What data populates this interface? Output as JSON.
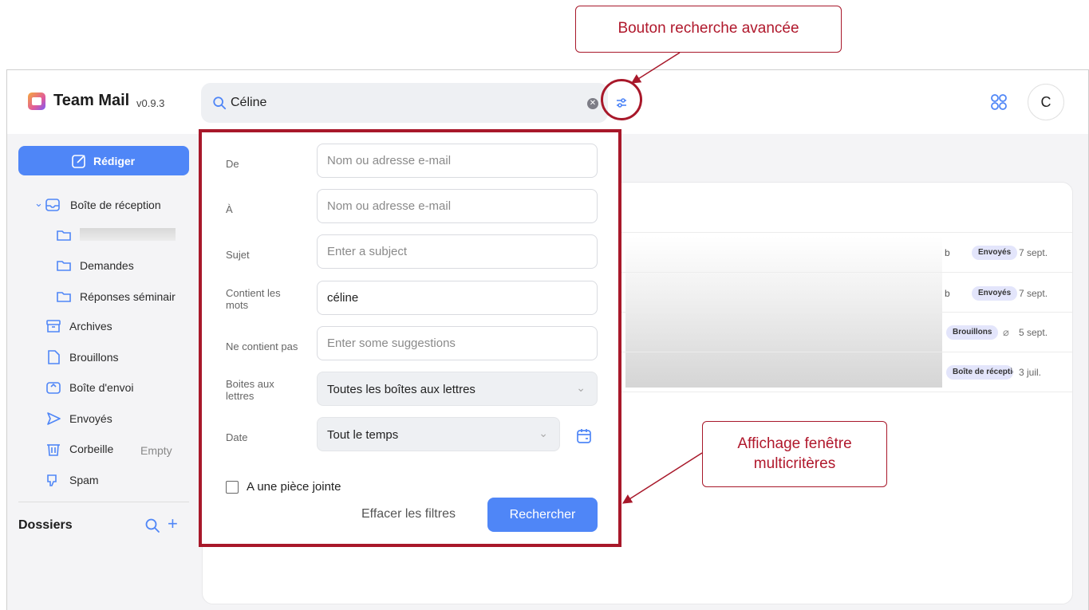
{
  "header": {
    "app_name": "Team Mail",
    "version": "v0.9.3",
    "search_value": "Céline",
    "avatar_initial": "C"
  },
  "sidebar": {
    "compose_label": "Rédiger",
    "items": [
      {
        "label": "Boîte de réception",
        "icon": "inbox-icon"
      },
      {
        "label": "",
        "icon": "folder-icon"
      },
      {
        "label": "Demandes",
        "icon": "folder-icon"
      },
      {
        "label": "Réponses séminair",
        "icon": "folder-icon"
      },
      {
        "label": "Archives",
        "icon": "archive-icon"
      },
      {
        "label": "Brouillons",
        "icon": "draft-icon"
      },
      {
        "label": "Boîte d'envoi",
        "icon": "outbox-icon"
      },
      {
        "label": "Envoyés",
        "icon": "send-icon"
      },
      {
        "label": "Corbeille",
        "icon": "trash-icon"
      },
      {
        "label": "Spam",
        "icon": "spam-icon"
      }
    ],
    "trash_action": "Empty",
    "folders_title": "Dossiers"
  },
  "messages": [
    {
      "fragment": "b",
      "tag": "Envoyés",
      "date": "7 sept."
    },
    {
      "fragment": "b",
      "tag": "Envoyés",
      "date": "7 sept."
    },
    {
      "fragment": "",
      "tag": "Brouillons",
      "date": "5 sept.",
      "attachment": true
    },
    {
      "fragment": "",
      "tag": "Boîte de réceptio",
      "date": "3 juil."
    }
  ],
  "advanced_search": {
    "from_label": "De",
    "from_placeholder": "Nom ou adresse e-mail",
    "to_label": "À",
    "to_placeholder": "Nom ou adresse e-mail",
    "subject_label": "Sujet",
    "subject_placeholder": "Enter a subject",
    "contains_label": "Contient les mots",
    "contains_value": "céline",
    "excludes_label": "Ne contient pas",
    "excludes_placeholder": "Enter some suggestions",
    "mailboxes_label": "Boites aux lettres",
    "mailboxes_value": "Toutes les boîtes aux lettres",
    "date_label": "Date",
    "date_value": "Tout le temps",
    "attachment_label": "A une pièce jointe",
    "attachment_checked": false,
    "clear_label": "Effacer les filtres",
    "submit_label": "Rechercher"
  },
  "annotations": {
    "advanced_button_callout": "Bouton recherche avancée",
    "window_callout": "Affichage fenêtre multicritères",
    "accent_color": "#a8182a"
  },
  "colors": {
    "primary": "#4f86f7",
    "tag_bg": "#e3e5fb"
  }
}
